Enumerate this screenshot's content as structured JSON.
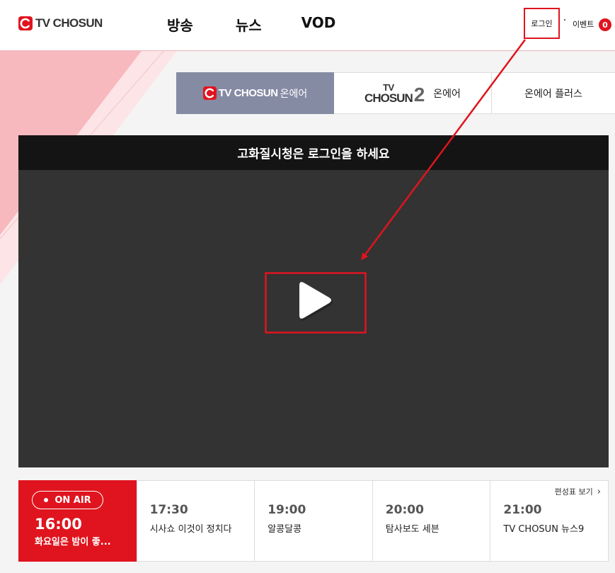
{
  "header": {
    "logo_text": "TV CHOSUN",
    "nav": [
      "방송",
      "뉴스",
      "VOD"
    ],
    "login_label": "로그인",
    "event_label": "이벤트",
    "event_count": "0"
  },
  "channel_tabs": {
    "tab1_logo": "TV CHOSUN",
    "tab1_label": "온에어",
    "tab2_logo_tv": "TV",
    "tab2_logo_chosun": "CHOSUN",
    "tab2_logo_num": "2",
    "tab2_label": "온에어",
    "tab3_label": "온에어 플러스"
  },
  "player": {
    "notice": "고화질시청은 로그인을 하세요"
  },
  "schedule": {
    "onair_badge": "ON AIR",
    "current": {
      "time": "16:00",
      "title": "화요일은 밤이 좋..."
    },
    "full_link": "편성표 보기",
    "upcoming": [
      {
        "time": "17:30",
        "title": "시사쇼 이것이 정치다"
      },
      {
        "time": "19:00",
        "title": "알콩달콩"
      },
      {
        "time": "20:00",
        "title": "탐사보도 세븐"
      },
      {
        "time": "21:00",
        "title": "TV CHOSUN 뉴스9"
      }
    ]
  },
  "colors": {
    "brand_red": "#e0141e",
    "tab_active": "#858ba3",
    "player_bg": "#333333",
    "annotation_red": "#e0141e"
  },
  "icons": [
    "tv-chosun-logo-icon",
    "play-icon",
    "chevron-right-icon",
    "live-dot-icon"
  ]
}
